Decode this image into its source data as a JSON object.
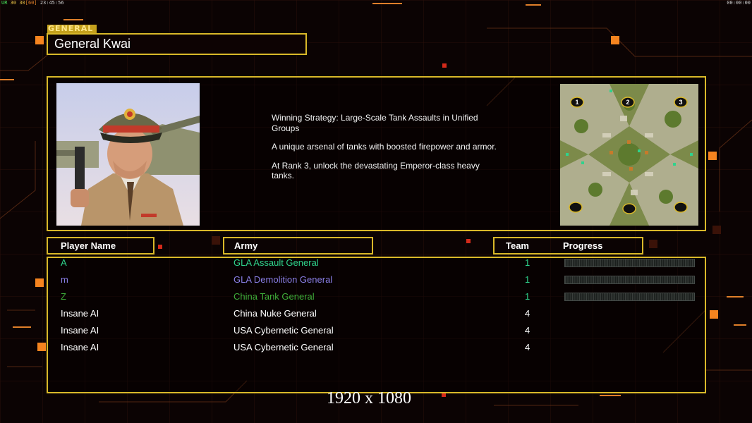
{
  "hud": {
    "stat_a": "UR",
    "stat_b": "30",
    "stat_c": "30",
    "stat_d": "[60]",
    "clock": "23:45:56",
    "timer": "00:00:00"
  },
  "general": {
    "tag": "GENERAL",
    "name": "General Kwai",
    "strategy_lines": [
      "Winning Strategy: Large-Scale Tank Assaults in Unified Groups",
      "A unique arsenal of tanks with boosted firepower and armor.",
      "At Rank 3, unlock the devastating Emperor-class heavy tanks."
    ]
  },
  "map": {
    "start_labels": [
      "1",
      "2",
      "3"
    ]
  },
  "columns": {
    "player": "Player Name",
    "army": "Army",
    "team": "Team",
    "progress": "Progress"
  },
  "players": [
    {
      "name": "A",
      "army": "GLA Assault General",
      "team": "1",
      "color": "#2fd38c",
      "show_progress": true
    },
    {
      "name": "m",
      "army": "GLA Demolition General",
      "team": "1",
      "color": "#8a7fe6",
      "show_progress": true
    },
    {
      "name": "Z",
      "army": "China Tank General",
      "team": "1",
      "color": "#3fae3a",
      "show_progress": true
    },
    {
      "name": "Insane AI",
      "army": "China Nuke General",
      "team": "4",
      "color": "#ffffff",
      "show_progress": false
    },
    {
      "name": "Insane AI",
      "army": "USA Cybernetic General",
      "team": "4",
      "color": "#ffffff",
      "show_progress": false
    },
    {
      "name": "Insane AI",
      "army": "USA Cybernetic General",
      "team": "4",
      "color": "#ffffff",
      "show_progress": false
    }
  ],
  "team_color": "#2fd38c",
  "resolution_label": "1920 x 1080"
}
